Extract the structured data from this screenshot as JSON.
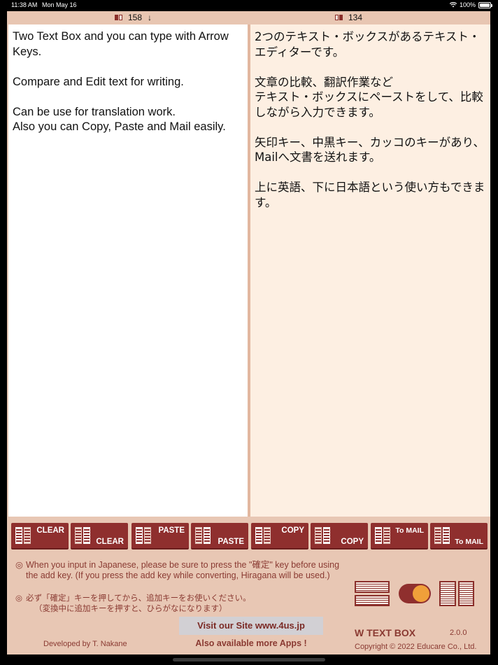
{
  "status_bar": {
    "time": "11:38 AM",
    "date": "Mon May 16",
    "battery": "100%"
  },
  "header": {
    "left_count": "158",
    "left_arrow": "↓",
    "right_count": "134"
  },
  "editor": {
    "left_text": "Two Text Box and you can type with Arrow Keys.\n\nCompare and Edit text for writing.\n\nCan be use for translation work.\nAlso you can Copy, Paste and Mail easily.",
    "right_text": "2つのテキスト・ボックスがあるテキスト・エディターです。\n\n文章の比較、翻訳作業など\nテキスト・ボックスにペーストをして、比較しながら入力できます。\n\n矢印キー、中黒キー、カッコのキーがあり、Mailへ文書を送れます。\n\n上に英語、下に日本語という使い方もできます。"
  },
  "buttons": {
    "clear_top": "CLEAR",
    "clear_bottom": "CLEAR",
    "paste_top": "PASTE",
    "paste_bottom": "PASTE",
    "copy_top": "COPY",
    "copy_bottom": "COPY",
    "mail_top": "To MAIL",
    "mail_bottom": "To MAIL"
  },
  "notes": {
    "mark": "◎",
    "english": "When you input in Japanese, please be sure to press the \"確定\" key before using the add key. (If you press the add key while converting, Hiragana will be used.)",
    "japanese_line1": "必ず「確定」キーを押してから、追加キーをお使いください。",
    "japanese_line2": "（変換中に追加キーを押すと、ひらがなになります）"
  },
  "footer": {
    "site_button": "Visit our Site www.4us.jp",
    "more_apps": "Also available more Apps !",
    "developer": "Developed by T. Nakane",
    "app_name": "W TEXT BOX",
    "version": "2.0.0",
    "copyright": "Copyright © 2022 Educare Co., Ltd."
  },
  "colors": {
    "accent": "#8f2f2e",
    "background": "#e8c7b4",
    "right_pane": "#fdefe2",
    "toggle_knob": "#f0a03a"
  },
  "layout_toggle": {
    "on": true
  }
}
